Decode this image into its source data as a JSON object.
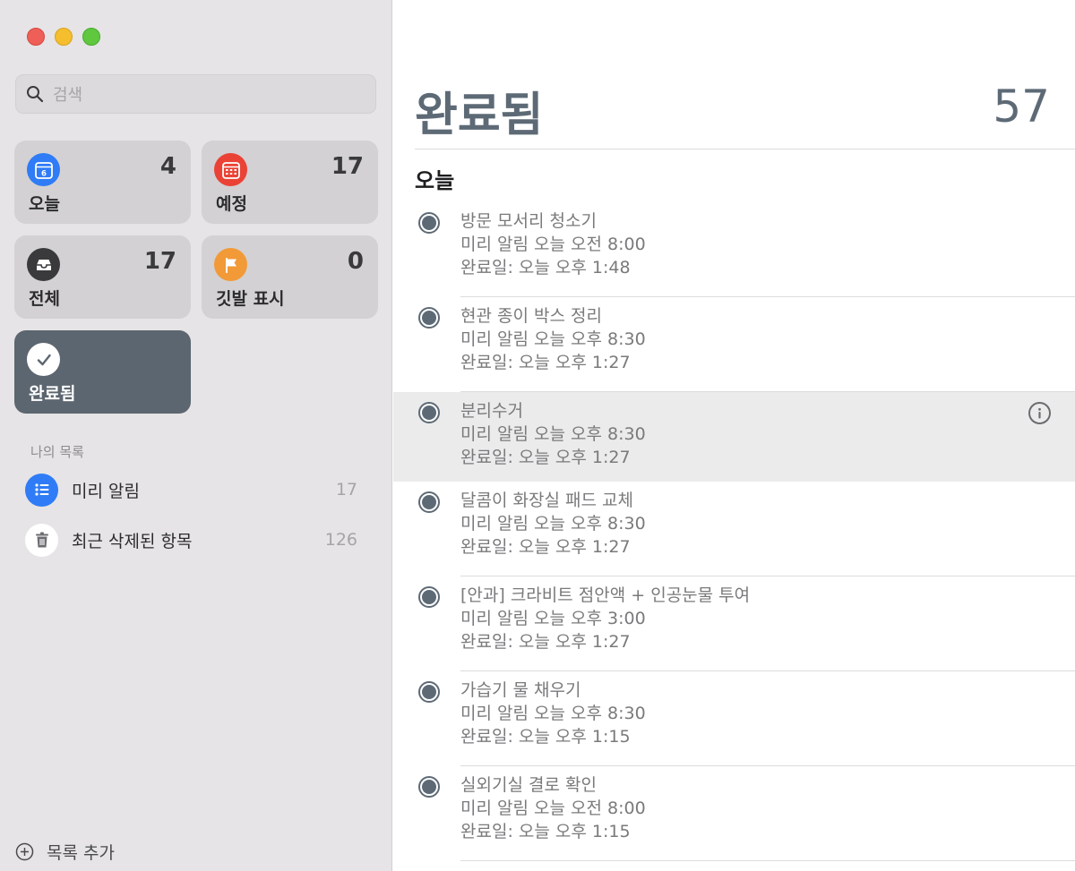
{
  "sidebar": {
    "search_placeholder": "검색",
    "cards": [
      {
        "label": "오늘",
        "count": "4",
        "icon": "calendar-today-icon",
        "color": "#2f7cf6",
        "icon_text": "6"
      },
      {
        "label": "예정",
        "count": "17",
        "icon": "calendar-grid-icon",
        "color": "#ea4335"
      },
      {
        "label": "전체",
        "count": "17",
        "icon": "tray-icon",
        "color": "#3a3a3c"
      },
      {
        "label": "깃발 표시",
        "count": "0",
        "icon": "flag-icon",
        "color": "#f19a37"
      },
      {
        "label": "완료됨",
        "count": "",
        "icon": "checkmark-icon",
        "color": "#ffffff"
      }
    ],
    "my_lists_title": "나의 목록",
    "lists": [
      {
        "name": "미리 알림",
        "count": "17",
        "icon": "list-bullet-icon",
        "color": "#2f7cf6"
      },
      {
        "name": "최근 삭제된 항목",
        "count": "126",
        "icon": "trash-icon",
        "color": "#ffffff"
      }
    ],
    "add_list_label": "목록 추가"
  },
  "main": {
    "title": "완료됨",
    "count": "57",
    "group_header": "오늘",
    "items": [
      {
        "title": "방문 모서리 청소기",
        "reminder": "미리 알림  오늘 오전 8:00",
        "completed": "완료일: 오늘 오후 1:48"
      },
      {
        "title": "현관 종이 박스 정리",
        "reminder": "미리 알림  오늘 오후 8:30",
        "completed": "완료일: 오늘 오후 1:27"
      },
      {
        "title": "분리수거",
        "reminder": "미리 알림  오늘 오후 8:30",
        "completed": "완료일: 오늘 오후 1:27",
        "selected": true
      },
      {
        "title": "달콤이 화장실 패드 교체",
        "reminder": "미리 알림  오늘 오후 8:30",
        "completed": "완료일: 오늘 오후 1:27"
      },
      {
        "title": "[안과] 크라비트 점안액 + 인공눈물 투여",
        "reminder": "미리 알림  오늘 오후 3:00",
        "completed": "완료일: 오늘 오후 1:27"
      },
      {
        "title": "가습기 물 채우기",
        "reminder": "미리 알림  오늘 오후 8:30",
        "completed": "완료일: 오늘 오후 1:15"
      },
      {
        "title": "실외기실 결로 확인",
        "reminder": "미리 알림  오늘 오전 8:00",
        "completed": "완료일: 오늘 오후 1:15"
      }
    ]
  }
}
